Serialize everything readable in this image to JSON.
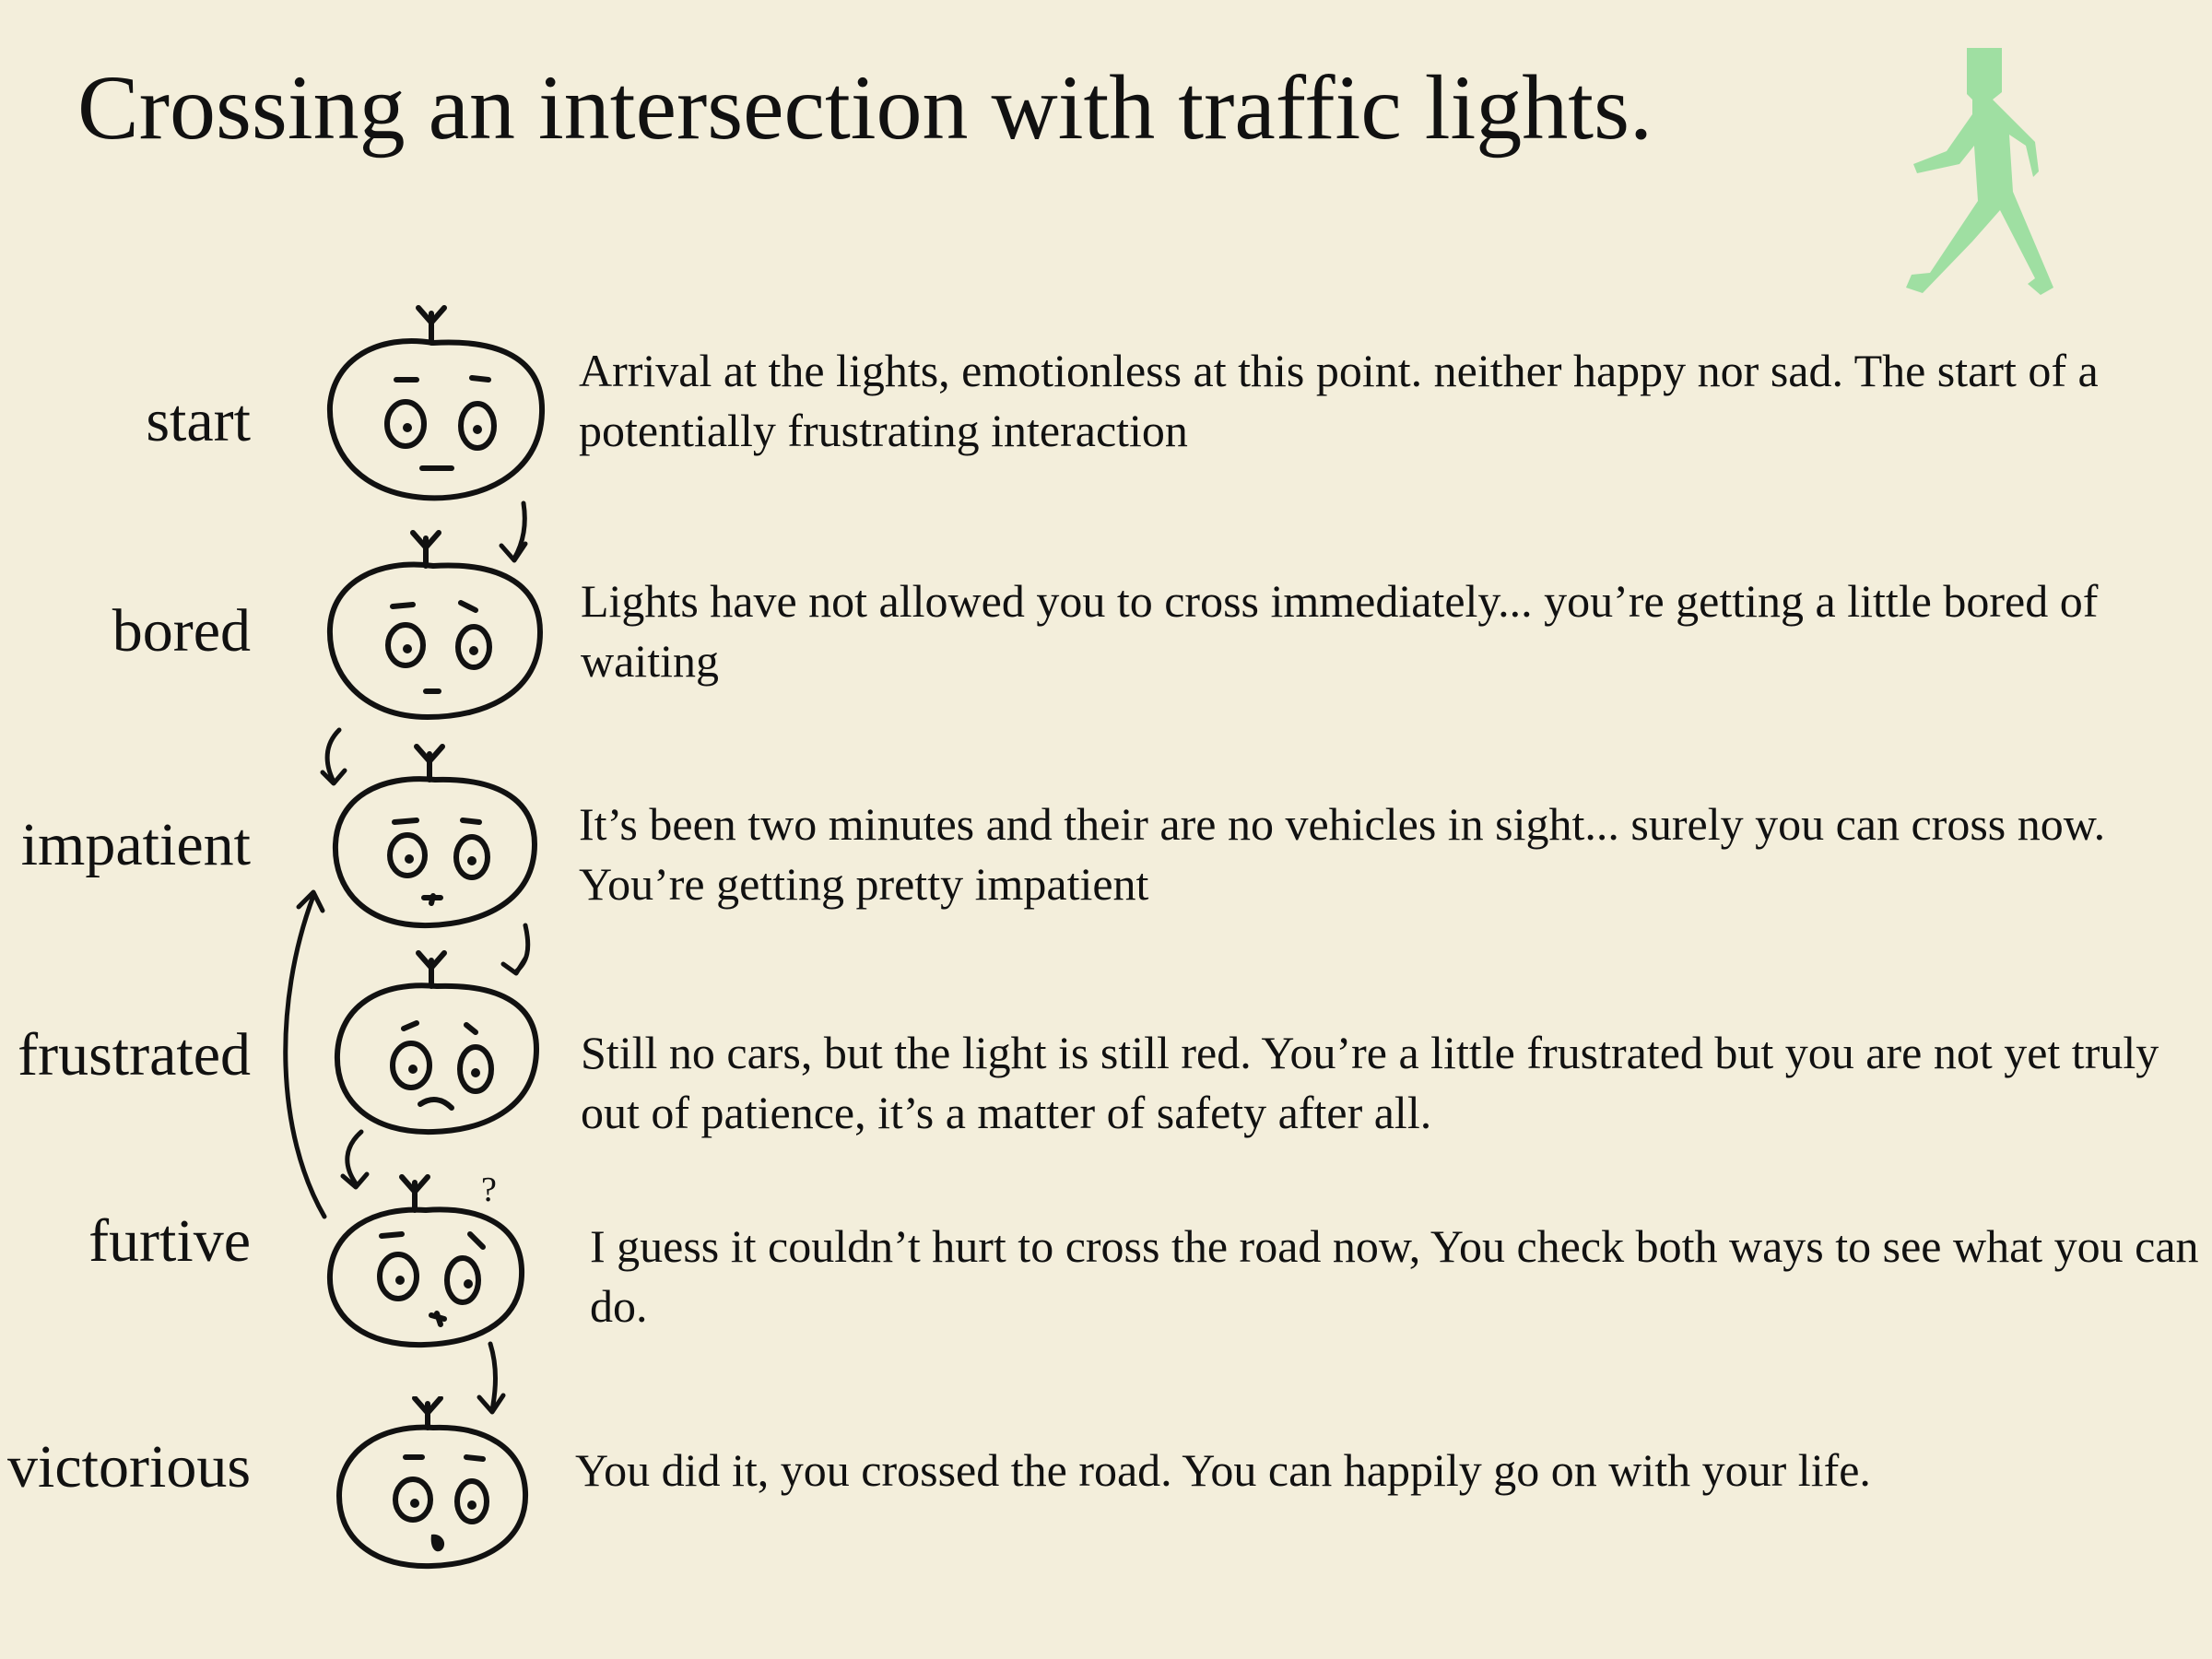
{
  "title": "Crossing an intersection with traffic lights.",
  "icons": {
    "pedestrian": "walking-pedestrian-icon",
    "face": "doodle-face-icon",
    "arrow": "curved-arrow-icon"
  },
  "colors": {
    "background": "#f3eedb",
    "pedestrian_green": "#9fdfa2",
    "ink": "#111111"
  },
  "stages": [
    {
      "label": "start",
      "description": "Arrival at the lights, emotionless at this point. neither happy nor sad. The start of a potentially frustrating interaction"
    },
    {
      "label": "bored",
      "description": "Lights have not allowed you to cross immediately... you’re getting a little bored of waiting"
    },
    {
      "label": "impatient",
      "description": "It’s been two minutes and their are no vehicles in sight... surely you can cross now. You’re getting pretty impatient"
    },
    {
      "label": "frustrated",
      "description": "Still no cars, but the light is still red. You’re a little frustrated but you are not yet truly out of patience, it’s a matter of safety after all."
    },
    {
      "label": "furtive",
      "description": "I guess it couldn’t hurt to cross the road now, You check both ways to see what you can do.",
      "face_mark": "?"
    },
    {
      "label": "victorious",
      "description": "You did it, you crossed the road. You can happily go on with your life."
    }
  ]
}
